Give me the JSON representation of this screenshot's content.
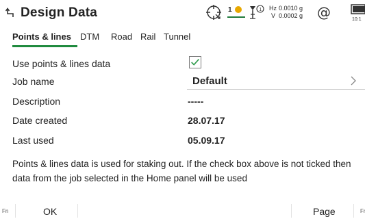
{
  "header": {
    "title": "Design Data",
    "sat_count": "1",
    "hz_label": "Hz",
    "hz_value": "0.0010 g",
    "v_label": "V",
    "v_value": "0.0002 g",
    "at_symbol": "@",
    "clock": "10:1"
  },
  "tabs": [
    {
      "label": "Points & lines"
    },
    {
      "label": "DTM"
    },
    {
      "label": "Road"
    },
    {
      "label": "Rail"
    },
    {
      "label": "Tunnel"
    }
  ],
  "rows": {
    "use_data": {
      "label": "Use points & lines data",
      "checked": true
    },
    "job_name": {
      "label": "Job name",
      "value": "Default"
    },
    "description": {
      "label": "Description",
      "value": "-----"
    },
    "date_created": {
      "label": "Date created",
      "value": "28.07.17"
    },
    "last_used": {
      "label": "Last used",
      "value": "05.09.17"
    }
  },
  "info_text": "Points & lines data is used for staking out. If the check box above is not ticked then data from the job selected in the Home panel will be used",
  "footer": {
    "fn_left": "Fn",
    "ok_label": "OK",
    "page_label": "Page",
    "fn_right": "Fn"
  },
  "colors": {
    "accent": "#1f8a3e",
    "check": "#2c9a4a"
  },
  "icons": [
    "back-icon",
    "target-icon",
    "satellite-icon",
    "prism-icon",
    "at-icon",
    "battery-icon",
    "check-icon",
    "chevron-right-icon"
  ]
}
